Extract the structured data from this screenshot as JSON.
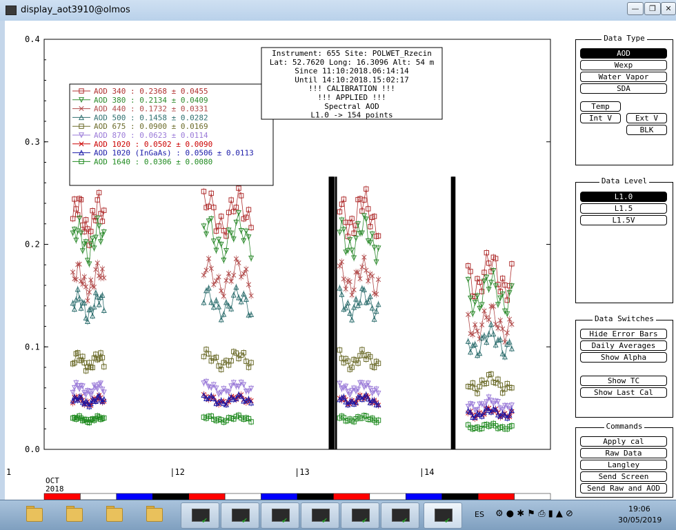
{
  "window": {
    "title": "display_aot3910@olmos"
  },
  "chart_data": {
    "type": "scatter",
    "ylim": [
      0,
      0.4
    ],
    "yticks": [
      "0.0",
      "0.1",
      "0.2",
      "0.3",
      "0.4"
    ],
    "xticks": [
      {
        "label": "1",
        "pos": 11
      },
      {
        "label": "|12",
        "pos": 12
      },
      {
        "label": "|13",
        "pos": 13
      },
      {
        "label": "|14",
        "pos": 14
      }
    ],
    "xlim": [
      10.97,
      15.03
    ],
    "month_label": "OCT",
    "year_label": "2018",
    "info_box": [
      "Instrument: 655 Site: POLWET_Rzecin",
      "Lat: 52.7620 Long: 16.3096 Alt: 54 m",
      "Since 11:10:2018.06:14:14",
      "Until 14:10:2018.15:02:17",
      "!!! CALIBRATION !!!",
      "!!!   APPLIED   !!!",
      "Spectral AOD",
      "L1.0 -> 154 points"
    ],
    "legend": [
      {
        "text": "AOD 340   : 0.2368 ± 0.0455",
        "color": "#b03030",
        "marker": "square"
      },
      {
        "text": "AOD 380   : 0.2134 ± 0.0409",
        "color": "#2e8b2e",
        "marker": "tri-down"
      },
      {
        "text": "AOD 440   : 0.1732 ± 0.0331",
        "color": "#b04848",
        "marker": "x"
      },
      {
        "text": "AOD 500   : 0.1458 ± 0.0282",
        "color": "#2f6f6f",
        "marker": "tri-up"
      },
      {
        "text": "AOD 675   : 0.0900 ± 0.0169",
        "color": "#6b6b2a",
        "marker": "square"
      },
      {
        "text": "AOD 870   : 0.0623 ± 0.0114",
        "color": "#9a7ad8",
        "marker": "tri-down"
      },
      {
        "text": "AOD 1020  : 0.0502 ± 0.0090",
        "color": "#cc0000",
        "marker": "x"
      },
      {
        "text": "AOD 1020  (InGaAs)  : 0.0506 ± 0.0113",
        "color": "#1a1aa8",
        "marker": "tri-up"
      },
      {
        "text": "AOD 1640  : 0.0306 ± 0.0080",
        "color": "#1f8a1f",
        "marker": "square"
      }
    ],
    "calibration_bars": [
      13.26,
      13.27,
      13.28,
      13.29,
      13.31,
      14.24,
      14.25,
      14.26
    ],
    "day_segments": [
      {
        "x0": 11.2,
        "x1": 11.45,
        "level": 0.225
      },
      {
        "x0": 12.25,
        "x1": 12.63,
        "level": 0.23
      },
      {
        "x0": 13.34,
        "x1": 13.65,
        "level": 0.23
      },
      {
        "x0": 14.37,
        "x1": 14.72,
        "level": 0.17
      }
    ],
    "channel_scales": [
      1.0,
      0.9,
      0.73,
      0.62,
      0.38,
      0.26,
      0.21,
      0.21,
      0.13
    ],
    "color_strip": [
      "#ff0000",
      "#ffffff",
      "#0000ff",
      "#000000",
      "#ff0000",
      "#ffffff",
      "#0000ff",
      "#000000",
      "#ff0000",
      "#ffffff",
      "#0000ff",
      "#000000",
      "#ff0000",
      "#ffffff"
    ]
  },
  "panels": {
    "data_type": {
      "title": "Data Type",
      "buttons": [
        "AOD",
        "Wexp",
        "Water Vapor",
        "SDA"
      ],
      "temp": "Temp",
      "int_v": "Int V",
      "ext_v": "Ext V",
      "blk": "BLK"
    },
    "data_level": {
      "title": "Data Level",
      "buttons": [
        "L1.0",
        "L1.5",
        "L1.5V"
      ]
    },
    "data_switches": {
      "title": "Data Switches",
      "buttons": [
        "Hide Error Bars",
        "Daily Averages",
        "Show Alpha",
        "Show TC",
        "Show Last Cal"
      ]
    },
    "commands": {
      "title": "Commands",
      "buttons": [
        "Apply cal",
        "Raw Data",
        "Langley",
        "Send Screen",
        "Send Raw and AOD"
      ]
    }
  },
  "taskbar": {
    "language": "ES",
    "time": "19:06",
    "date": "30/05/2019"
  }
}
